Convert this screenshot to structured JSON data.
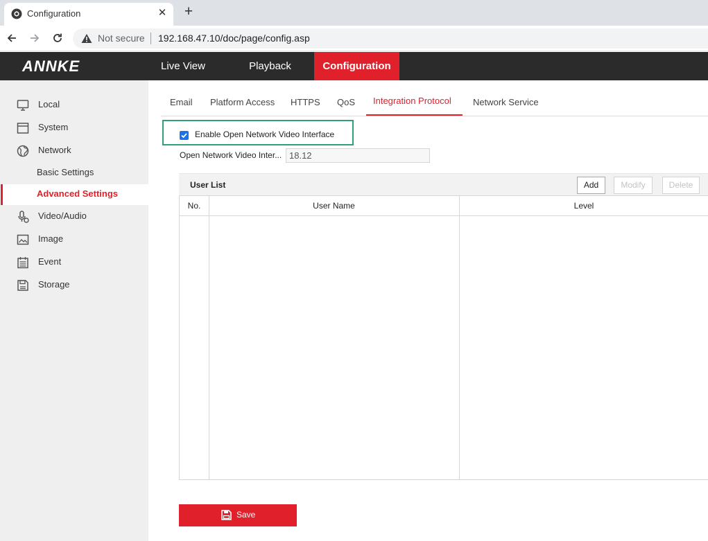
{
  "browser": {
    "tab_title": "Configuration",
    "close_glyph": "✕",
    "new_tab_glyph": "+",
    "not_secure": "Not secure",
    "url": "192.168.47.10/doc/page/config.asp"
  },
  "header": {
    "logo": "ANNKE",
    "nav": [
      "Live View",
      "Playback",
      "Configuration"
    ],
    "active_nav": "Configuration",
    "accent_color": "#e0202a",
    "bar_color": "#2b2b2b"
  },
  "sidebar": {
    "items": [
      {
        "label": "Local",
        "icon": "monitor-icon"
      },
      {
        "label": "System",
        "icon": "window-icon"
      },
      {
        "label": "Network",
        "icon": "globe-icon"
      },
      {
        "label": "Basic Settings",
        "sub": true
      },
      {
        "label": "Advanced Settings",
        "sub": true,
        "active": true
      },
      {
        "label": "Video/Audio",
        "icon": "microphone-icon"
      },
      {
        "label": "Image",
        "icon": "image-icon"
      },
      {
        "label": "Event",
        "icon": "calendar-icon"
      },
      {
        "label": "Storage",
        "icon": "save-disk-icon"
      }
    ]
  },
  "subtabs": [
    "Email",
    "Platform Access",
    "HTTPS",
    "QoS",
    "Integration Protocol",
    "Network Service"
  ],
  "active_subtab": "Integration Protocol",
  "form": {
    "enable_label": "Enable Open Network Video Interface",
    "enable_checked": true,
    "onvif_label": "Open Network Video Inter...",
    "onvif_version": "18.12"
  },
  "user_list": {
    "title": "User List",
    "add_label": "Add",
    "modify_label": "Modify",
    "delete_label": "Delete",
    "columns": [
      "No.",
      "User Name",
      "Level"
    ],
    "rows": []
  },
  "save_label": "Save"
}
